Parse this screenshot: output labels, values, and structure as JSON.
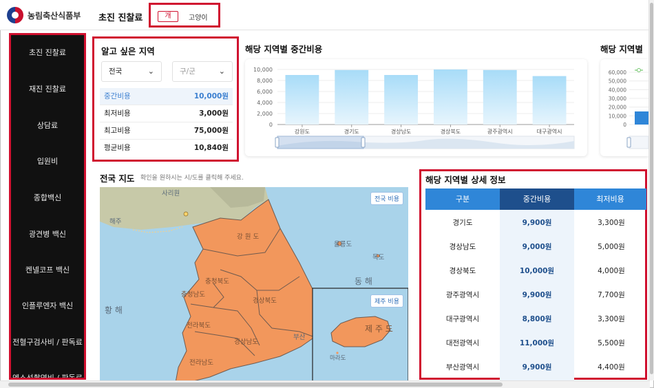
{
  "header": {
    "logo_text": "농림축산식품부",
    "page_title": "초진 진찰료",
    "pet_tabs": {
      "dog": "개",
      "cat": "고양이"
    }
  },
  "sidebar": {
    "items": [
      "초진 진찰료",
      "재진 진찰료",
      "상담료",
      "입원비",
      "종합백신",
      "광견병 백신",
      "켄넬코프 백신",
      "인플루엔자 백신",
      "전혈구검사비 / 판독료",
      "엑스선촬영비 / 판독료"
    ]
  },
  "region_panel": {
    "title": "알고 싶은 지역",
    "province": "전국",
    "district_placeholder": "구/군",
    "stats": [
      {
        "label": "중간비용",
        "value": "10,000원"
      },
      {
        "label": "최저비용",
        "value": "3,000원"
      },
      {
        "label": "최고비용",
        "value": "75,000원"
      },
      {
        "label": "평균비용",
        "value": "10,840원"
      }
    ]
  },
  "charts": {
    "median_title": "해당 지역별 중간비용",
    "second_title": "해당 지역별"
  },
  "chart_data": [
    {
      "type": "bar",
      "title": "해당 지역별 중간비용",
      "categories": [
        "강원도",
        "경기도",
        "경상남도",
        "경상북도",
        "광주광역시",
        "대구광역시"
      ],
      "values": [
        9000,
        9900,
        9000,
        10000,
        9900,
        8800
      ],
      "ylim": [
        0,
        10000
      ],
      "yticks": [
        "0",
        "2,000",
        "4,000",
        "6,000",
        "8,000",
        "10,000"
      ],
      "xlabel": "",
      "ylabel": "",
      "grid": true,
      "color": "#bfe3f8"
    },
    {
      "type": "line",
      "title": "해당 지역별",
      "ylim": [
        0,
        60000
      ],
      "yticks": [
        "0",
        "10,000",
        "20,000",
        "30,000",
        "40,000",
        "50,000",
        "60,000"
      ],
      "series": [
        {
          "values": []
        }
      ],
      "legend": "top"
    }
  ],
  "map": {
    "title": "전국 지도",
    "hint": "확인을 원하시는 시/도를 클릭해 주세요.",
    "national_btn": "전국 비용",
    "jeju_btn": "제주 비용",
    "labels": {
      "east_sea": "동 해",
      "yellow_sea": "황 해",
      "gangwon": "강 원 도",
      "gyeongbuk": "경상북도",
      "gyeongnam": "경상남도",
      "jeonbuk": "전라북도",
      "jeonnam": "전라남도",
      "chungbuk": "충청북도",
      "chungnam": "충청남도",
      "jeju": "제 주 도",
      "ulleung": "울릉도",
      "dokdo": "독도",
      "sariwon": "사리원",
      "haeju": "해주",
      "busan": "부산",
      "marado": "마라도"
    }
  },
  "detail": {
    "title": "해당 지역별 상세 정보",
    "columns": [
      "구분",
      "중간비용",
      "최저비용"
    ],
    "rows": [
      [
        "경기도",
        "9,900원",
        "3,300원"
      ],
      [
        "경상남도",
        "9,000원",
        "5,000원"
      ],
      [
        "경상북도",
        "10,000원",
        "4,000원"
      ],
      [
        "광주광역시",
        "9,900원",
        "7,700원"
      ],
      [
        "대구광역시",
        "8,800원",
        "3,300원"
      ],
      [
        "대전광역시",
        "11,000원",
        "5,500원"
      ],
      [
        "부산광역시",
        "9,900원",
        "4,400원"
      ]
    ]
  },
  "colors": {
    "accent_red": "#d0102f",
    "header_blue": "#2f86d8",
    "header_navy": "#1e4f8c",
    "link_blue": "#3b7fd0",
    "map_land": "#f2975c",
    "map_sea": "#a9d3ea"
  }
}
